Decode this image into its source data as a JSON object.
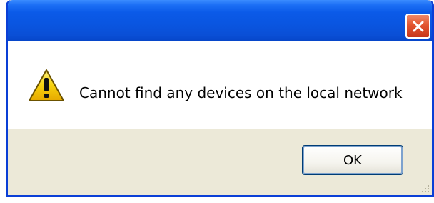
{
  "dialog": {
    "title": "",
    "message": "Cannot find any devices on the local network",
    "icon": "warning-icon",
    "ok_label": "OK",
    "close_icon": "close-icon"
  },
  "colors": {
    "titlebar": "#0a55e0",
    "close_button": "#e3552f",
    "content_bg": "#ffffff",
    "button_area_bg": "#ece9d8",
    "ok_border": "#003c74",
    "warning_yellow": "#f7d20e"
  }
}
